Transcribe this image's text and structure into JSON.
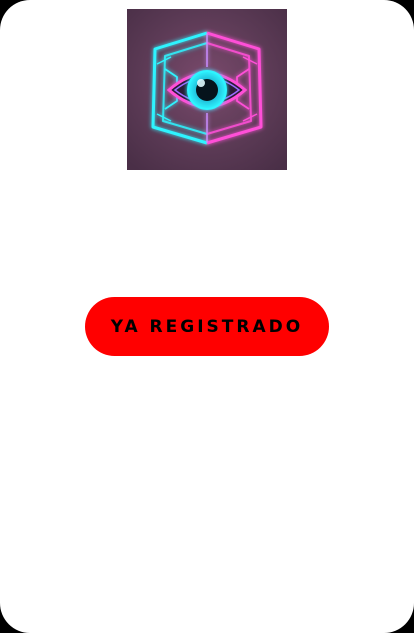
{
  "logo": {
    "icon": "neon-eye-hexagon-icon",
    "colors": {
      "background": "#5b3a55",
      "cyan_neon": "#2ff4ff",
      "pink_neon": "#ff4fd8",
      "iris": "#1aa7c9"
    }
  },
  "action": {
    "button_label": "YA REGISTRADO",
    "button_color": "#ff0000",
    "button_text_color": "#000000"
  },
  "theme": {
    "card_background": "#ffffff",
    "page_background": "#000000"
  }
}
